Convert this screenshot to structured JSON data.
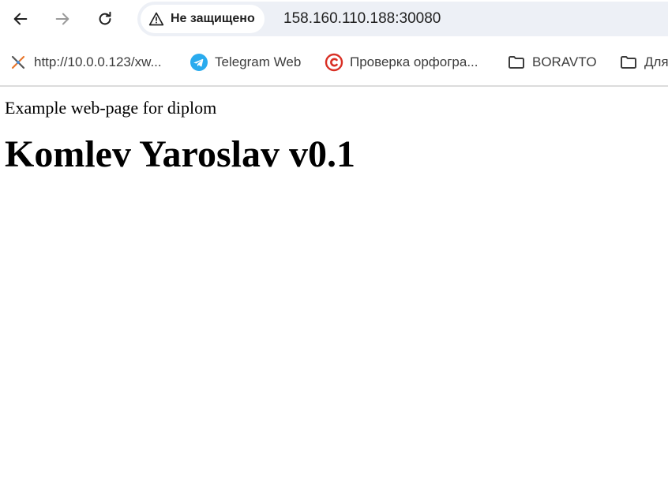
{
  "browser": {
    "security_label": "Не защищено",
    "url": "158.160.110.188:30080",
    "bookmarks": [
      {
        "label": "http://10.0.0.123/xw...",
        "icon": "tool-icon"
      },
      {
        "label": "Telegram Web",
        "icon": "telegram-icon"
      },
      {
        "label": "Проверка орфогра...",
        "icon": "copyright-icon"
      },
      {
        "label": "BORAVTO",
        "icon": "folder-icon"
      },
      {
        "label": "Для",
        "icon": "folder-icon"
      }
    ]
  },
  "page": {
    "text": "Example web-page for diplom",
    "heading": "Komlev Yaroslav v0.1"
  },
  "colors": {
    "omnibox_bg": "#edf0f6",
    "telegram": "#2aabee",
    "copyright_red": "#d93025"
  }
}
